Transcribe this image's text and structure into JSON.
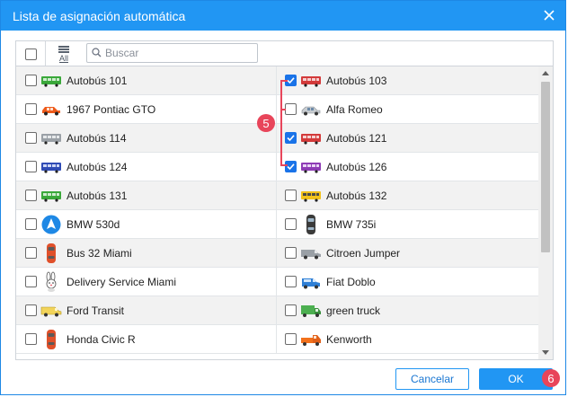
{
  "dialog": {
    "title": "Lista de asignación automática",
    "close_icon": "close-icon"
  },
  "toolbar": {
    "all_label": "All",
    "search_placeholder": "Buscar",
    "search_value": ""
  },
  "rows": [
    {
      "left": {
        "label": "Autobús 101",
        "checked": false,
        "icon": "green-bus-icon"
      },
      "right": {
        "label": "Autobús 103",
        "checked": true,
        "icon": "red-bus-icon"
      }
    },
    {
      "left": {
        "label": "1967 Pontiac GTO",
        "checked": false,
        "icon": "orange-car-icon"
      },
      "right": {
        "label": "Alfa Romeo",
        "checked": false,
        "icon": "silver-car-icon"
      }
    },
    {
      "left": {
        "label": "Autobús 114",
        "checked": false,
        "icon": "gray-bus-icon"
      },
      "right": {
        "label": "Autobús 121",
        "checked": true,
        "icon": "red-bus-icon"
      }
    },
    {
      "left": {
        "label": "Autobús 124",
        "checked": false,
        "icon": "blue-bus-icon"
      },
      "right": {
        "label": "Autobús 126",
        "checked": true,
        "icon": "purple-bus-icon"
      }
    },
    {
      "left": {
        "label": "Autobús 131",
        "checked": false,
        "icon": "green-bus-icon"
      },
      "right": {
        "label": "Autobús 132",
        "checked": false,
        "icon": "yellow-bus-icon"
      }
    },
    {
      "left": {
        "label": "BMW 530d",
        "checked": false,
        "icon": "navigation-arrow-icon"
      },
      "right": {
        "label": "BMW 735i",
        "checked": false,
        "icon": "car-top-view-icon"
      }
    },
    {
      "left": {
        "label": "Bus 32 Miami",
        "checked": false,
        "icon": "red-car-top-icon"
      },
      "right": {
        "label": "Citroen Jumper",
        "checked": false,
        "icon": "gray-van-icon"
      }
    },
    {
      "left": {
        "label": "Delivery Service Miami",
        "checked": false,
        "icon": "bunny-icon"
      },
      "right": {
        "label": "Fiat Doblo",
        "checked": false,
        "icon": "blue-van-icon"
      }
    },
    {
      "left": {
        "label": "Ford Transit",
        "checked": false,
        "icon": "yellow-van-icon"
      },
      "right": {
        "label": "green truck",
        "checked": false,
        "icon": "green-truck-icon"
      }
    },
    {
      "left": {
        "label": "Honda Civic R",
        "checked": false,
        "icon": "red-car-top-icon"
      },
      "right": {
        "label": "Kenworth",
        "checked": false,
        "icon": "orange-truck-icon"
      }
    }
  ],
  "callouts": {
    "first": "5",
    "second": "6"
  },
  "buttons": {
    "cancel": "Cancelar",
    "ok": "OK"
  },
  "colors": {
    "accent": "#2196f3",
    "callout": "#e8455a",
    "checked": "#1a73e8"
  }
}
